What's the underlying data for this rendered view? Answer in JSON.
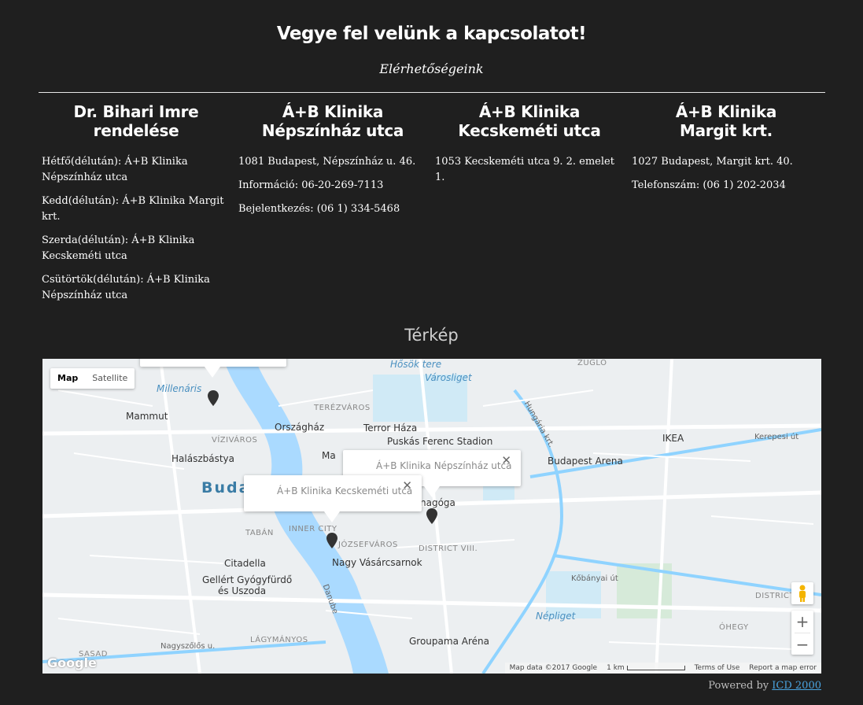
{
  "header": {
    "title": "Vegye fel velünk a kapcsolatot!",
    "subtitle": "Elérhetőségeink"
  },
  "columns": [
    {
      "title_line1": "Dr. Bihari Imre",
      "title_line2": "rendelése",
      "lines": [
        "Hétfő(délután): Á+B Klinika Népszínház utca",
        "Kedd(délután): Á+B Klinika Margit krt.",
        "Szerda(délután): Á+B Klinika Kecskeméti utca",
        "Csütörtök(délután): Á+B Klinika Népszínház utca"
      ]
    },
    {
      "title_line1": "Á+B Klinika",
      "title_line2": "Népszínház utca",
      "lines": [
        "1081 Budapest, Népszínház u. 46.",
        "Információ: 06-20-269-7113",
        "Bejelentkezés: (06 1) 334-5468"
      ]
    },
    {
      "title_line1": "Á+B Klinika",
      "title_line2": "Kecskeméti utca",
      "lines": [
        "1053 Kecskeméti utca 9. 2. emelet 1."
      ]
    },
    {
      "title_line1": "Á+B Klinika",
      "title_line2": "Margit krt.",
      "lines": [
        "1027 Budapest, Margit krt. 40.",
        "Telefonszám: (06 1) 202-2034"
      ]
    }
  ],
  "map": {
    "title": "Térkép",
    "type_map": "Map",
    "type_satellite": "Satellite",
    "popup_nepszinhaz": "Á+B Klinika Népszínház utca",
    "popup_kecskemeti": "Á+B Klinika Kecskeméti utca",
    "close_glyph": "✕",
    "zoom_in": "+",
    "zoom_out": "−",
    "google_logo": "Google",
    "map_data": "Map data ©2017 Google",
    "scale": "1 km",
    "terms": "Terms of Use",
    "report": "Report a map error",
    "labels": {
      "millenaris": "Millenáris",
      "mammut": "Mammut",
      "viziváros": "VÍZIVÁROS",
      "halaszbastya": "Halászbástya",
      "orszaghaz": "Országház",
      "terror": "Terror Háza",
      "terezvaros": "TERÉZVÁROS",
      "hosok": "Hősök tere",
      "varosliget": "Városliget",
      "zuglo": "ZUGLÓ",
      "puskas": "Puskás Ferenc Stadion",
      "arena": "Budapest Arena",
      "ikea": "IKEA",
      "buda": "Buda",
      "tabán": "TABÁN",
      "inner": "INNER CITY",
      "jozsef": "JÓZSEFVÁROS",
      "dist8": "DISTRICT VIII.",
      "citadella": "Citadella",
      "nagyvasar": "Nagy Vásárcsarnok",
      "gellert1": "Gellért Gyógyfürdő",
      "gellert2": "és Uszoda",
      "nepliget": "Népliget",
      "lagym": "LÁGYMÁNYOS",
      "groupama": "Groupama Aréna",
      "sasad": "SASAD",
      "ohegy": "ÓHEGY",
      "district": "DISTRICT",
      "nagyszolos": "Nagyszőlős u.",
      "kobanyai": "Kőbányai út",
      "kerepesi": "Kerepesi út",
      "hungaria": "Hungária krt.",
      "danube": "Danube",
      "ma": "Ma",
      "nagoga": "nagóga"
    }
  },
  "footer": {
    "powered": "Powered by",
    "link": "ICD 2000"
  }
}
